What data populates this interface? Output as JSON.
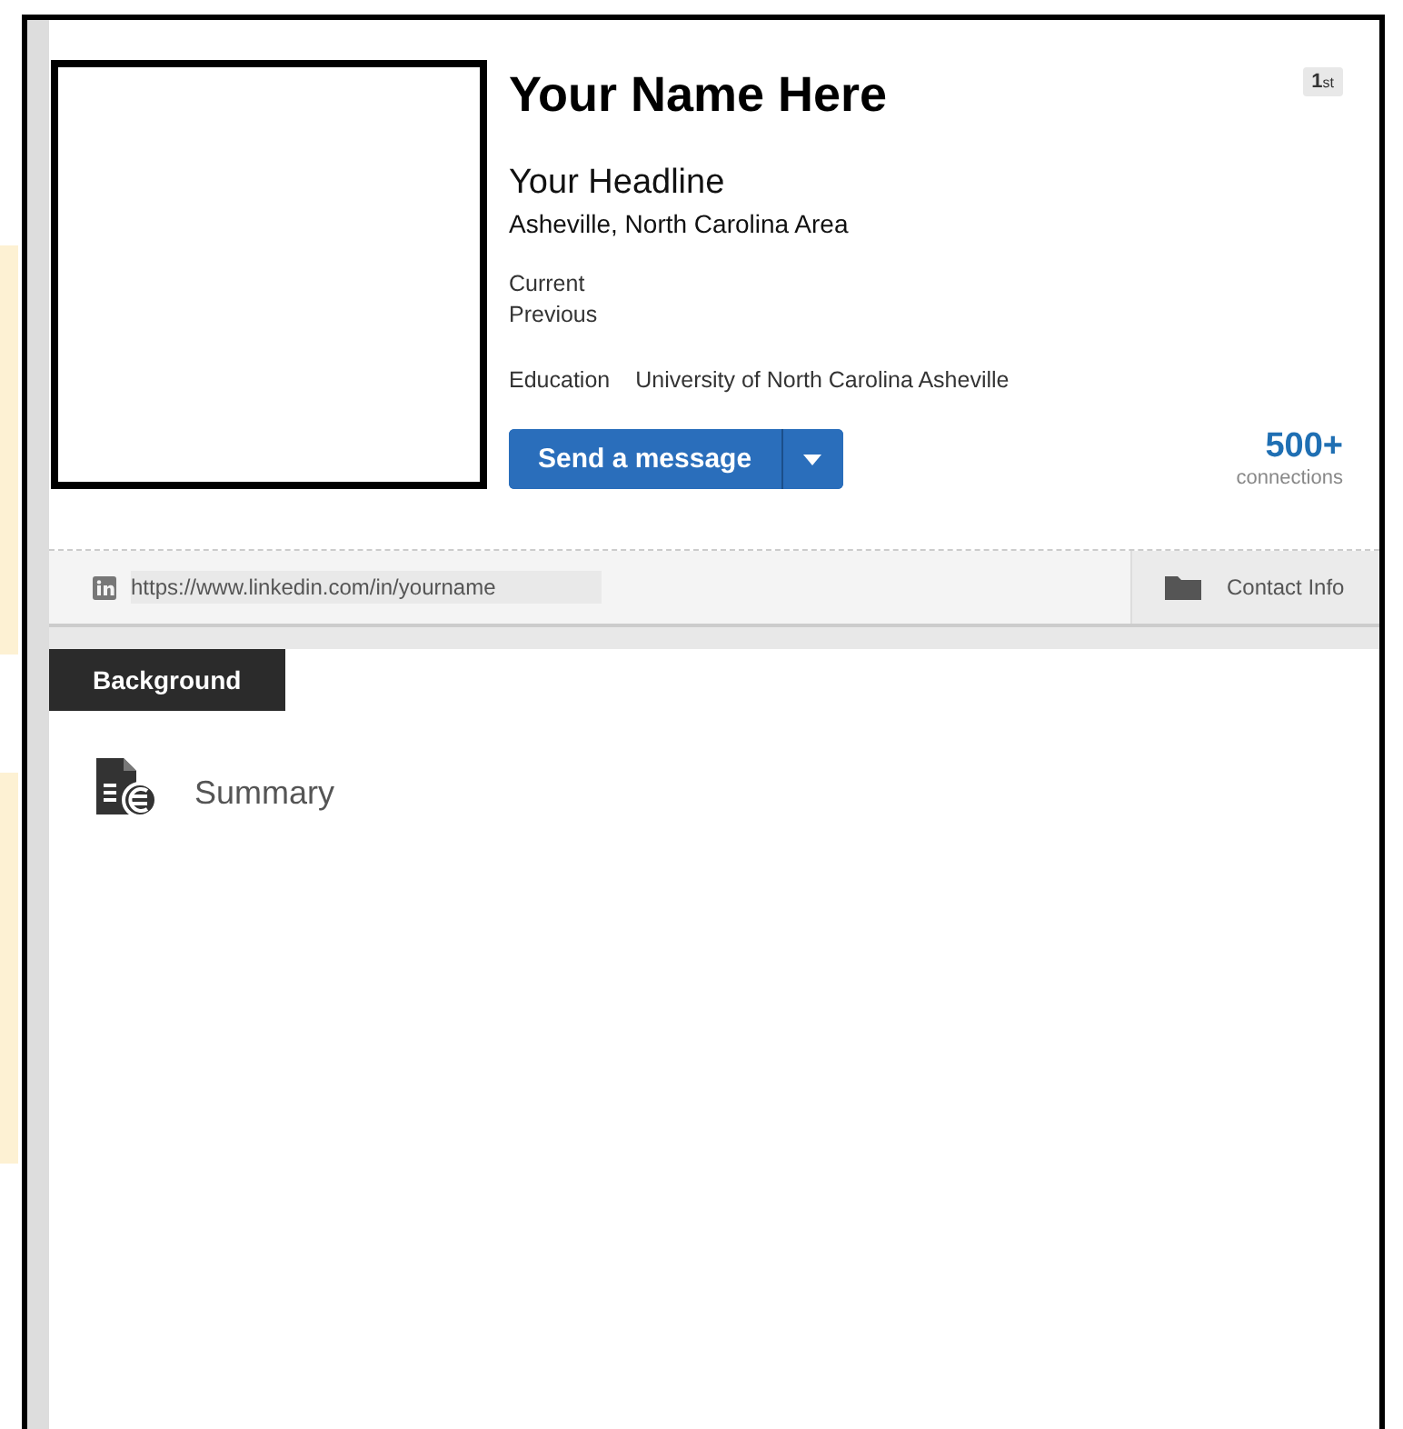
{
  "profile": {
    "name": "Your Name Here",
    "degree_badge": "1$_{st}$",
    "headline": "Your Headline",
    "location": "Asheville, North Carolina Area",
    "current_label": "Current",
    "previous_label": "Previous",
    "education_label": "Education",
    "education_value": "University of North Carolina Asheville",
    "message_button": "Send a message",
    "connections_count": "500+",
    "connections_label": "connections"
  },
  "url_bar": {
    "url": "https://www.linkedin.com/in/yourname",
    "contact_label": "Contact Info"
  },
  "section_tab": "Background",
  "summary": {
    "heading": "Summary"
  }
}
